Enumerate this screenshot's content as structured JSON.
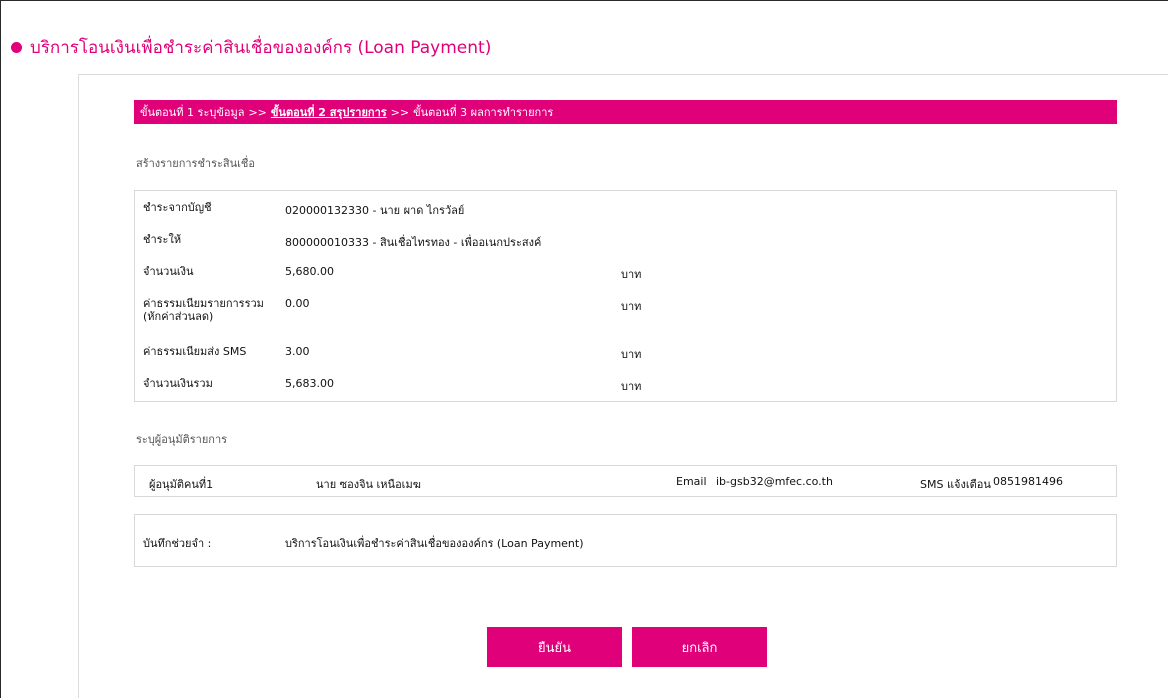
{
  "title": "บริการโอนเงินเพื่อชำระค่าสินเชื่อขององค์กร (Loan Payment)",
  "accent_color": "#e0007a",
  "steps": {
    "step1": "ขั้นตอนที่ 1 ระบุข้อมูล",
    "sep1": ">>",
    "step2": "ขั้นตอนที่ 2 สรุปรายการ",
    "sep2": ">>",
    "step3": "ขั้นตอนที่ 3 ผลการทำรายการ"
  },
  "summary": {
    "heading": "สร้างรายการชำระสินเชื่อ",
    "rows": [
      {
        "label": "ชำระจากบัญชี",
        "value": "020000132330 - นาย ผาด ไกรวัลย์",
        "unit": ""
      },
      {
        "label": "ชำระให้",
        "value": "800000010333 - สินเชื่อไทรทอง - เพื่ออเนกประสงค์",
        "unit": ""
      },
      {
        "label": "จำนวนเงิน",
        "value": "5,680.00",
        "unit": "บาท"
      },
      {
        "label": "ค่าธรรมเนียมรายการรวม (หักค่าส่วนลด)",
        "value": "0.00",
        "unit": "บาท"
      },
      {
        "label": "ค่าธรรมเนียมส่ง SMS",
        "value": "3.00",
        "unit": "บาท"
      },
      {
        "label": "จำนวนเงินรวม",
        "value": "5,683.00",
        "unit": "บาท"
      }
    ]
  },
  "approvers": {
    "heading": "ระบุผู้อนุมัติรายการ",
    "label": "ผู้อนุมัติคนที่1",
    "name": "นาย ซองจิน เหนือเมฆ",
    "email_label": "Email",
    "email": "ib-gsb32@mfec.co.th",
    "sms_label": "SMS แจ้งเตือน",
    "sms": "0851981496"
  },
  "memo": {
    "label": "บันทึกช่วยจำ :",
    "value": "บริการโอนเงินเพื่อชำระค่าสินเชื่อขององค์กร (Loan Payment)"
  },
  "buttons": {
    "confirm": "ยืนยัน",
    "cancel": "ยกเลิก"
  }
}
